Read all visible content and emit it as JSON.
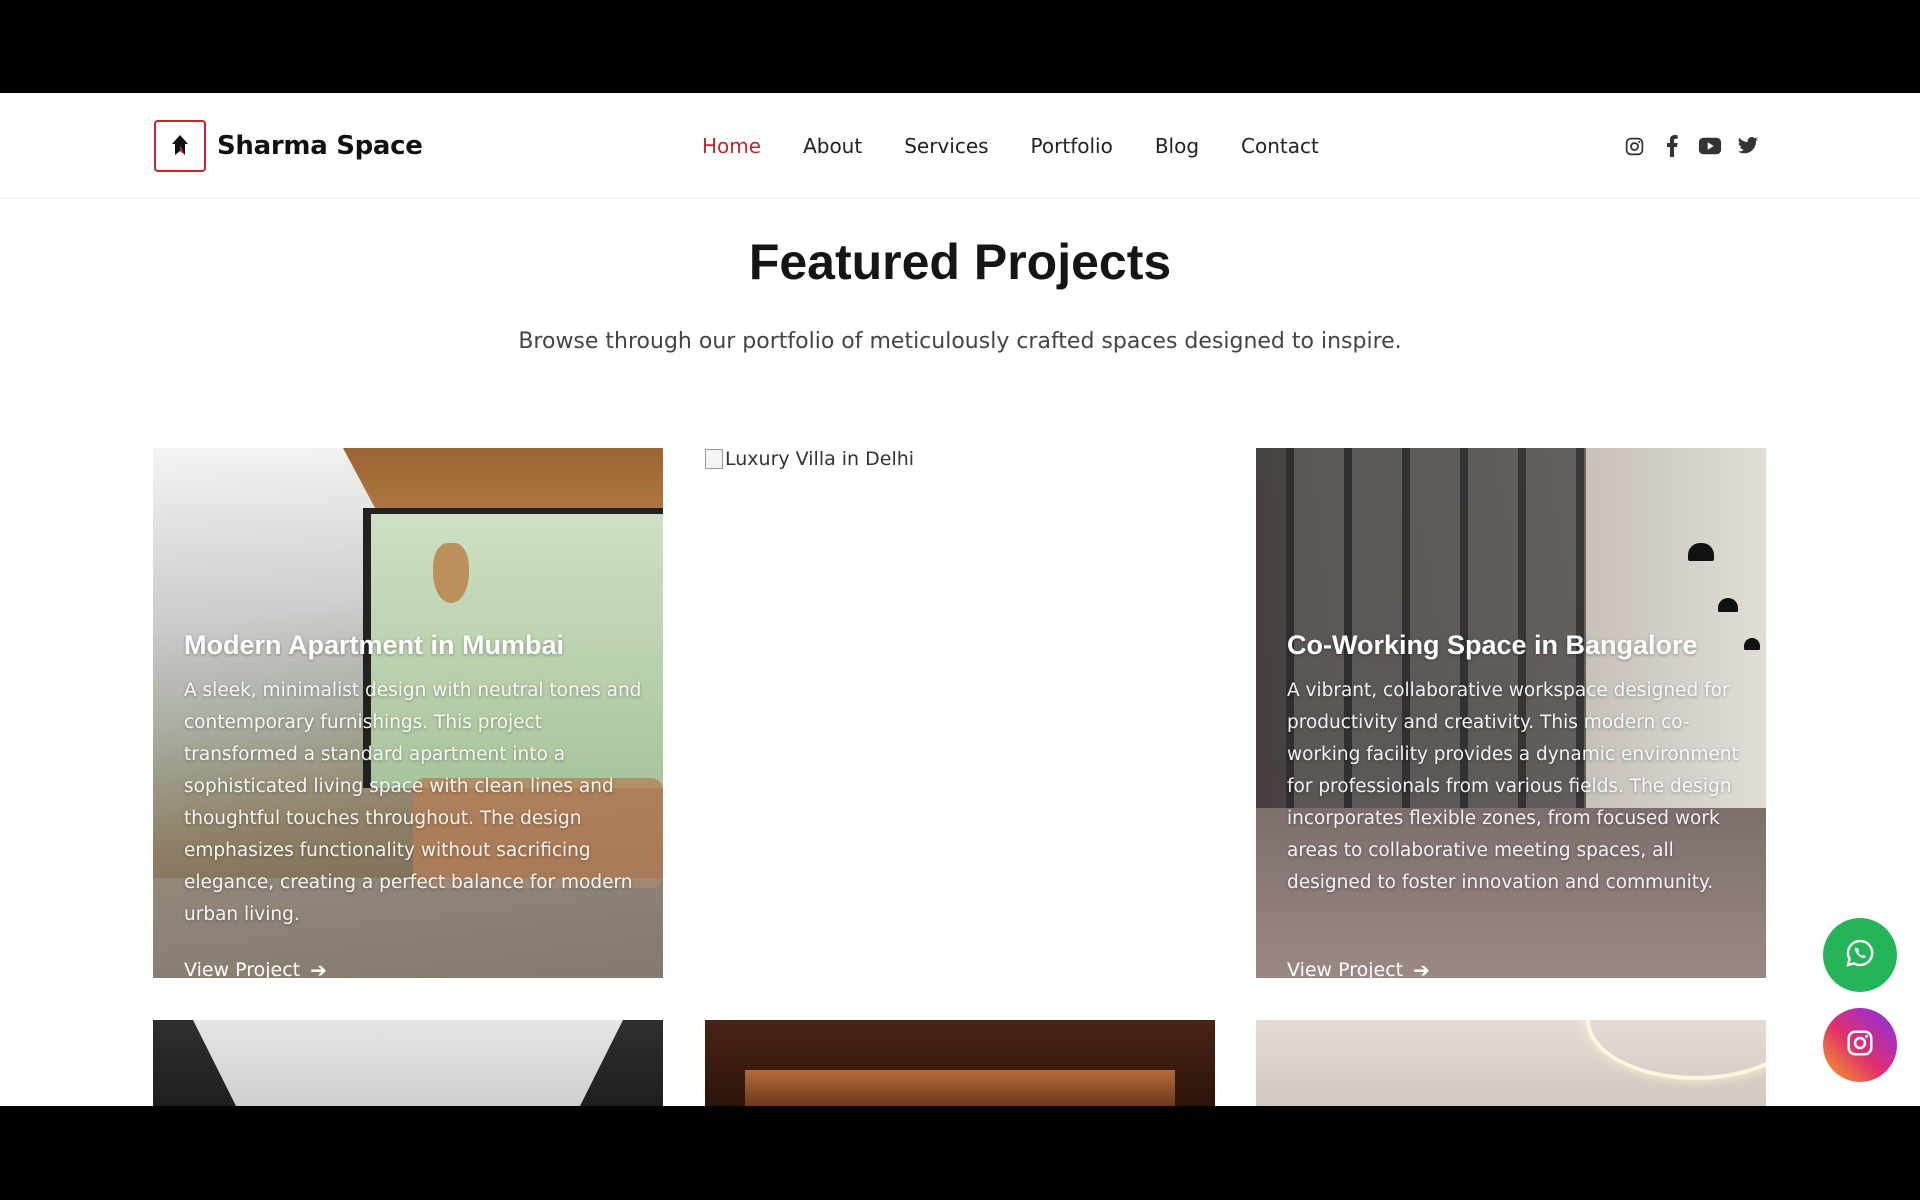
{
  "brand": {
    "name": "Sharma Space",
    "accent_color": "#c0262d"
  },
  "nav": {
    "items": [
      {
        "label": "Home",
        "active": true
      },
      {
        "label": "About",
        "active": false
      },
      {
        "label": "Services",
        "active": false
      },
      {
        "label": "Portfolio",
        "active": false
      },
      {
        "label": "Blog",
        "active": false
      },
      {
        "label": "Contact",
        "active": false
      }
    ]
  },
  "social": [
    "instagram-icon",
    "facebook-icon",
    "youtube-icon",
    "twitter-icon"
  ],
  "section": {
    "title": "Featured Projects",
    "subtitle": "Browse through our portfolio of meticulously crafted spaces designed to inspire."
  },
  "projects": [
    {
      "title": "Modern Apartment in Mumbai",
      "description": "A sleek, minimalist design with neutral tones and contemporary furnishings. This project transformed a standard apartment into a sophisticated living space with clean lines and thoughtful touches throughout. The design emphasizes functionality without sacrificing elegance, creating a perfect balance for modern urban living.",
      "link": "View Project"
    },
    {
      "image_alt": "Luxury Villa in Delhi"
    },
    {
      "title": "Co-Working Space in Bangalore",
      "description": "A vibrant, collaborative workspace designed for productivity and creativity. This modern co-working facility provides a dynamic environment for professionals from various fields. The design incorporates flexible zones, from focused work areas to collaborative meeting spaces, all designed to foster innovation and community.",
      "link": "View Project"
    }
  ],
  "floating": {
    "whatsapp": "whatsapp-icon",
    "instagram": "instagram-icon"
  }
}
